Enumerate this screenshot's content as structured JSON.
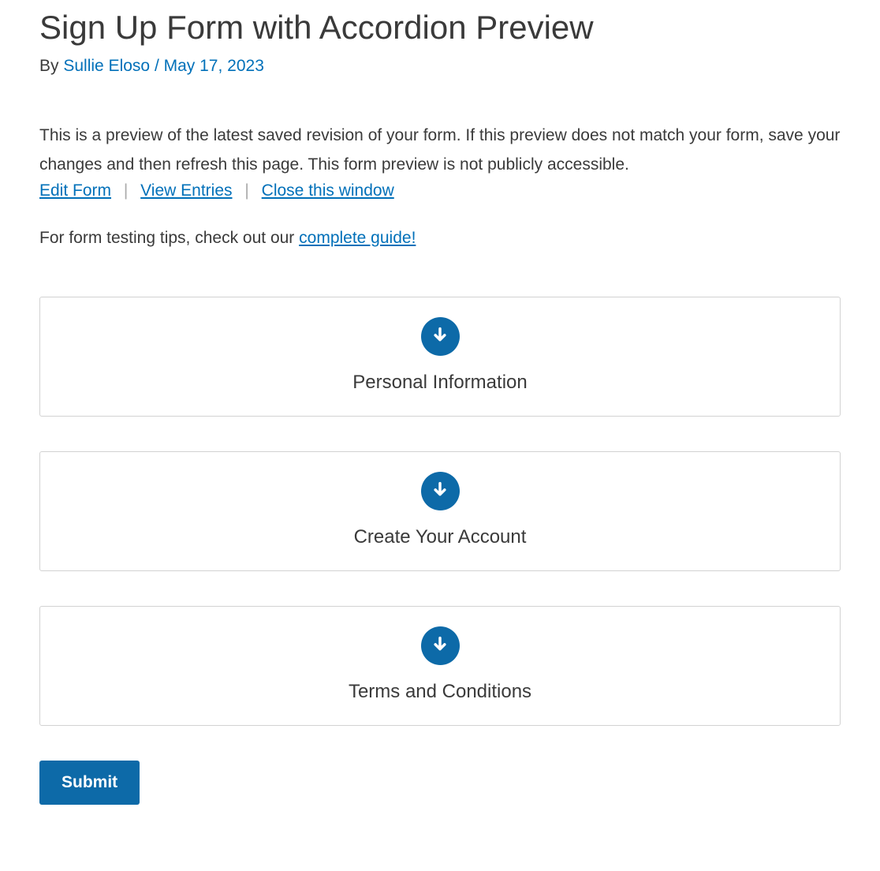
{
  "title": "Sign Up Form with Accordion Preview",
  "meta": {
    "by_label": "By",
    "author": "Sullie Eloso",
    "separator": "/",
    "date": "May 17, 2023"
  },
  "intro": "This is a preview of the latest saved revision of your form. If this preview does not match your form, save your changes and then refresh this page. This form preview is not publicly accessible.",
  "links": {
    "edit_form": "Edit Form",
    "view_entries": "View Entries",
    "close_window": "Close this window"
  },
  "tips": {
    "prefix": "For form testing tips, check out our ",
    "link_text": "complete guide!"
  },
  "accordions": [
    {
      "title": "Personal Information"
    },
    {
      "title": "Create Your Account"
    },
    {
      "title": "Terms and Conditions"
    }
  ],
  "submit_label": "Submit"
}
